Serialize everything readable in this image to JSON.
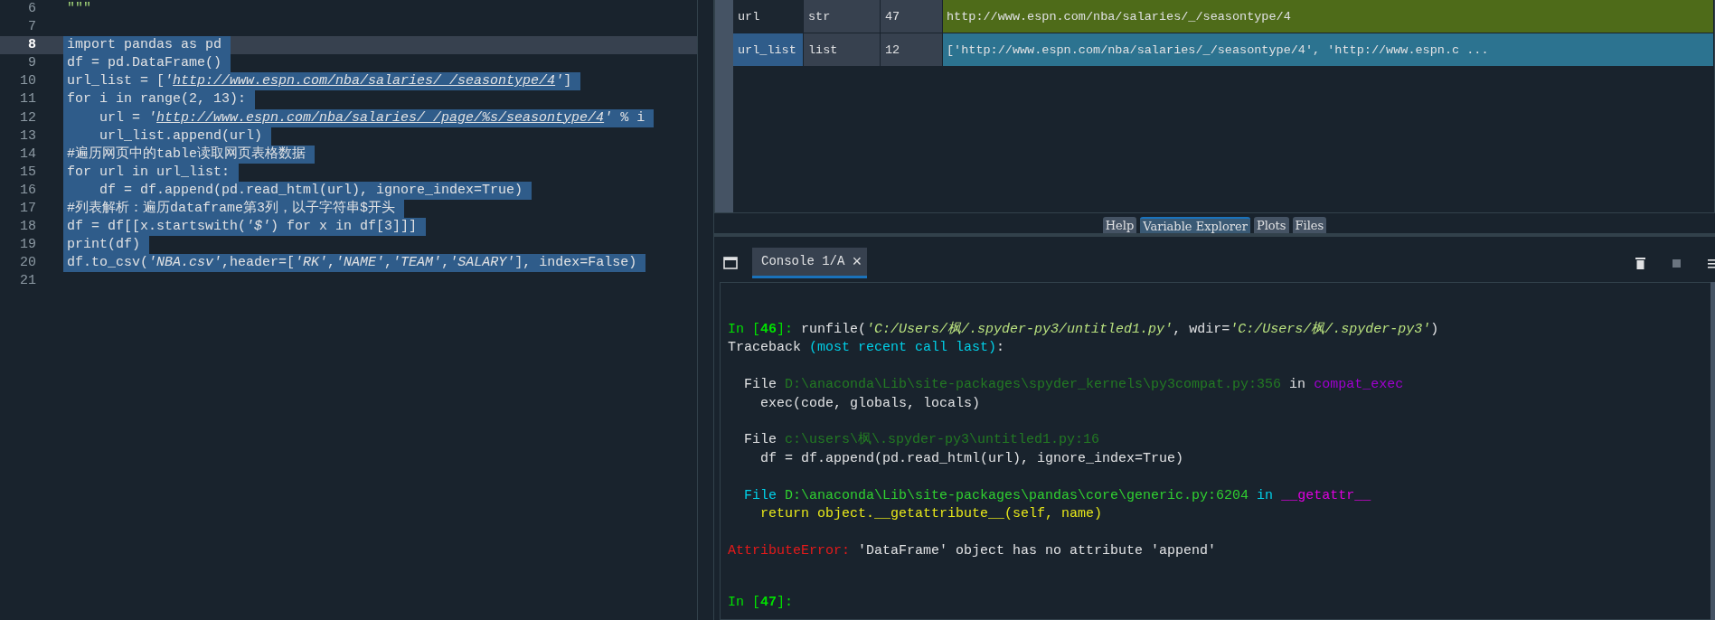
{
  "editor": {
    "lines": [
      {
        "number": "6",
        "current": false,
        "selected": false,
        "segments": [
          {
            "text": "\"\"\"",
            "kind": "docstring"
          }
        ]
      },
      {
        "number": "7",
        "current": false,
        "selected": false
      },
      {
        "number": "8",
        "current": true,
        "selected": true,
        "segments": [
          {
            "text": "import pandas as pd",
            "kind": "code"
          }
        ]
      },
      {
        "number": "9",
        "current": false,
        "selected": true,
        "segments": [
          {
            "text": "df = pd.DataFrame()",
            "kind": "code"
          }
        ]
      },
      {
        "number": "10",
        "current": false,
        "selected": true,
        "segments": [
          {
            "text": "url_list = [",
            "kind": "code"
          },
          {
            "text": "'",
            "kind": "string"
          },
          {
            "text": "http://www.espn.com/nba/salaries/_/seasontype/4",
            "kind": "url"
          },
          {
            "text": "'",
            "kind": "string"
          },
          {
            "text": "]",
            "kind": "code"
          }
        ]
      },
      {
        "number": "11",
        "current": false,
        "selected": true,
        "segments": [
          {
            "text": "for i in range(2, 13):",
            "kind": "code"
          }
        ]
      },
      {
        "number": "12",
        "current": false,
        "selected": true,
        "segments": [
          {
            "text": "    url = ",
            "kind": "code"
          },
          {
            "text": "'",
            "kind": "string"
          },
          {
            "text": "http://www.espn.com/nba/salaries/_/page/%s/seasontype/4",
            "kind": "url"
          },
          {
            "text": "'",
            "kind": "string"
          },
          {
            "text": " % i",
            "kind": "code"
          }
        ]
      },
      {
        "number": "13",
        "current": false,
        "selected": true,
        "segments": [
          {
            "text": "    url_list.append(url)",
            "kind": "code"
          }
        ]
      },
      {
        "number": "14",
        "current": false,
        "selected": true,
        "segments": [
          {
            "text": "#遍历网页中的table读取网页表格数据",
            "kind": "comment"
          }
        ]
      },
      {
        "number": "15",
        "current": false,
        "selected": true,
        "segments": [
          {
            "text": "for url in url_list:",
            "kind": "code"
          }
        ]
      },
      {
        "number": "16",
        "current": false,
        "selected": true,
        "segments": [
          {
            "text": "    df = df.append(pd.read_html(url), ignore_index=True)",
            "kind": "code"
          }
        ]
      },
      {
        "number": "17",
        "current": false,
        "selected": true,
        "segments": [
          {
            "text": "#列表解析：遍历dataframe第3列，以子字符串$开头",
            "kind": "comment"
          }
        ]
      },
      {
        "number": "18",
        "current": false,
        "selected": true,
        "segments": [
          {
            "text": "df = df[[x.startswith(",
            "kind": "code"
          },
          {
            "text": "'$'",
            "kind": "string"
          },
          {
            "text": ") for x in df[3]]]",
            "kind": "code"
          }
        ]
      },
      {
        "number": "19",
        "current": false,
        "selected": true,
        "segments": [
          {
            "text": "print(df)",
            "kind": "code"
          }
        ]
      },
      {
        "number": "20",
        "current": false,
        "selected": true,
        "segments": [
          {
            "text": "df.to_csv(",
            "kind": "code"
          },
          {
            "text": "'NBA.csv'",
            "kind": "string"
          },
          {
            "text": ",header=[",
            "kind": "code"
          },
          {
            "text": "'RK'",
            "kind": "string"
          },
          {
            "text": ",",
            "kind": "code"
          },
          {
            "text": "'NAME'",
            "kind": "string"
          },
          {
            "text": ",",
            "kind": "code"
          },
          {
            "text": "'TEAM'",
            "kind": "string"
          },
          {
            "text": ",",
            "kind": "code"
          },
          {
            "text": "'SALARY'",
            "kind": "string"
          },
          {
            "text": "], index=False)",
            "kind": "code"
          }
        ]
      },
      {
        "number": "21",
        "current": false,
        "selected": false
      }
    ]
  },
  "variable_explorer": {
    "rows": [
      {
        "name": "url",
        "type": "str",
        "size": "47",
        "value": "http://www.espn.com/nba/salaries/_/seasontype/4",
        "color": "#4e6b19",
        "selected": false
      },
      {
        "name": "url_list",
        "type": "list",
        "size": "12",
        "value": "['http://www.espn.com/nba/salaries/_/seasontype/4', 'http://www.espn.c ...",
        "color": "#2c7390",
        "selected": true
      }
    ]
  },
  "pane_tabs": [
    {
      "label": "Help",
      "selected": false
    },
    {
      "label": "Variable Explorer",
      "selected": true
    },
    {
      "label": "Plots",
      "selected": false
    },
    {
      "label": "Files",
      "selected": false
    }
  ],
  "console": {
    "tab": {
      "label": "Console 1/A",
      "close": "×"
    },
    "entries": [
      {
        "lines": [
          [
            {
              "text": "In [",
              "kind": "prompt"
            },
            {
              "text": "46",
              "kind": "prompt-num"
            },
            {
              "text": "]: ",
              "kind": "prompt"
            },
            {
              "text": "runfile(",
              "kind": "text"
            },
            {
              "text": "'C:/Users/枫/.spyder-py3/untitled1.py'",
              "kind": "string"
            },
            {
              "text": ", wdir=",
              "kind": "text"
            },
            {
              "text": "'C:/Users/枫/.spyder-py3'",
              "kind": "string"
            },
            {
              "text": ")",
              "kind": "text"
            }
          ],
          [
            {
              "text": "Traceback ",
              "kind": "text"
            },
            {
              "text": "(most recent call last)",
              "kind": "cyan"
            },
            {
              "text": ":",
              "kind": "text"
            }
          ]
        ]
      },
      {
        "lines": [
          [
            {
              "text": "  File ",
              "kind": "text"
            },
            {
              "text": "D:\\anaconda\\Lib\\site-packages\\spyder_kernels\\py3compat.py:356",
              "kind": "path"
            },
            {
              "text": " in ",
              "kind": "text"
            },
            {
              "text": "compat_exec",
              "kind": "func"
            }
          ],
          [
            {
              "text": "    exec(code, globals, locals)",
              "kind": "text"
            }
          ]
        ]
      },
      {
        "lines": [
          [
            {
              "text": "  File ",
              "kind": "text"
            },
            {
              "text": "c:\\users\\枫\\.spyder-py3\\untitled1.py:16",
              "kind": "path"
            }
          ],
          [
            {
              "text": "    df = df.append(pd.read_html(url), ignore_index=True)",
              "kind": "text"
            }
          ]
        ]
      },
      {
        "lines": [
          [
            {
              "text": "  File ",
              "kind": "cyan"
            },
            {
              "text": "D:\\anaconda\\Lib\\site-packages\\pandas\\core\\generic.py:6204",
              "kind": "green"
            },
            {
              "text": " in ",
              "kind": "cyan"
            },
            {
              "text": "__getattr__",
              "kind": "magenta"
            }
          ],
          [
            {
              "text": "    return object.__getattribute__(self, name)",
              "kind": "yellow"
            }
          ]
        ]
      },
      {
        "lines": [
          [
            {
              "text": "AttributeError: ",
              "kind": "error"
            },
            {
              "text": "'DataFrame' object has no attribute 'append'",
              "kind": "text"
            }
          ]
        ]
      }
    ],
    "prompt": [
      {
        "text": "In [",
        "kind": "prompt"
      },
      {
        "text": "47",
        "kind": "prompt-num"
      },
      {
        "text": "]:",
        "kind": "prompt"
      }
    ]
  }
}
